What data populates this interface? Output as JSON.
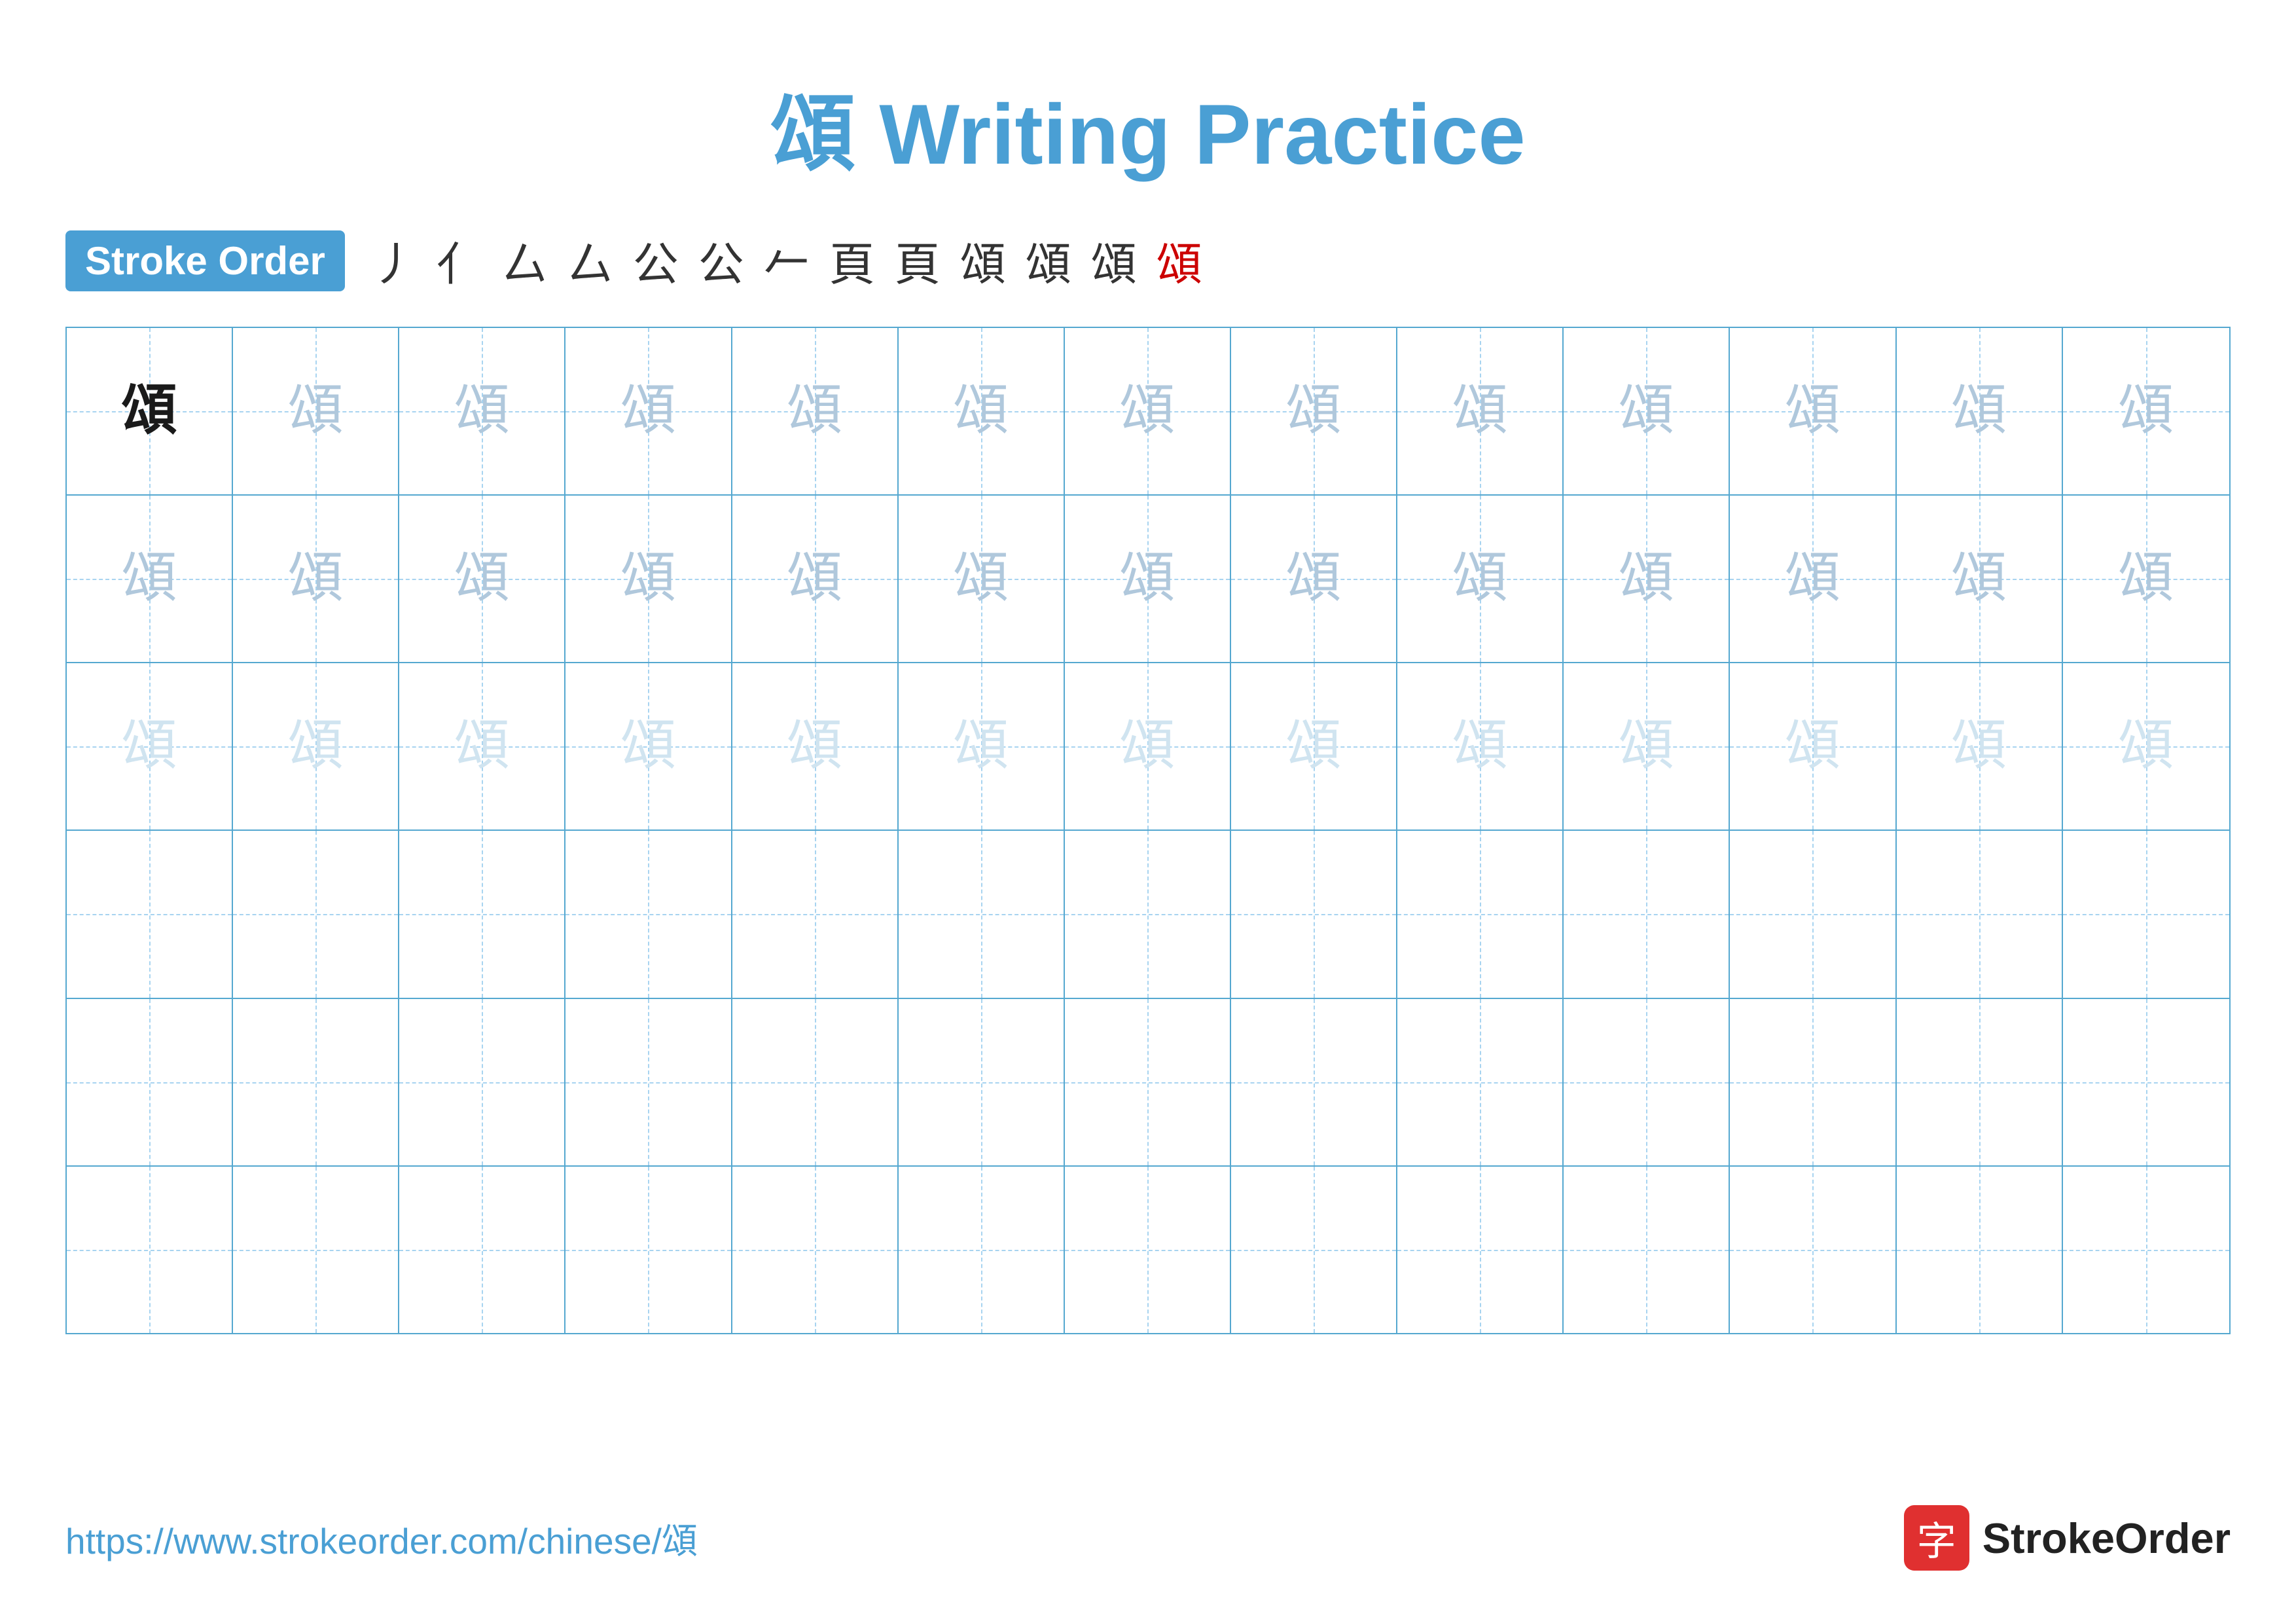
{
  "title": "頌 Writing Practice",
  "stroke_order_badge": "Stroke Order",
  "stroke_steps": [
    "丿",
    "亻",
    "厶",
    "厶",
    "公",
    "公",
    "𠂉",
    "頁",
    "頁",
    "頌",
    "頌",
    "頌",
    "頌"
  ],
  "character": "頌",
  "rows": [
    {
      "type": "dark-then-medium",
      "cells": [
        {
          "char": "頌",
          "style": "dark"
        },
        {
          "char": "頌",
          "style": "medium"
        },
        {
          "char": "頌",
          "style": "medium"
        },
        {
          "char": "頌",
          "style": "medium"
        },
        {
          "char": "頌",
          "style": "medium"
        },
        {
          "char": "頌",
          "style": "medium"
        },
        {
          "char": "頌",
          "style": "medium"
        },
        {
          "char": "頌",
          "style": "medium"
        },
        {
          "char": "頌",
          "style": "medium"
        },
        {
          "char": "頌",
          "style": "medium"
        },
        {
          "char": "頌",
          "style": "medium"
        },
        {
          "char": "頌",
          "style": "medium"
        },
        {
          "char": "頌",
          "style": "medium"
        }
      ]
    },
    {
      "type": "medium",
      "cells": [
        {
          "char": "頌",
          "style": "medium"
        },
        {
          "char": "頌",
          "style": "medium"
        },
        {
          "char": "頌",
          "style": "medium"
        },
        {
          "char": "頌",
          "style": "medium"
        },
        {
          "char": "頌",
          "style": "medium"
        },
        {
          "char": "頌",
          "style": "medium"
        },
        {
          "char": "頌",
          "style": "medium"
        },
        {
          "char": "頌",
          "style": "medium"
        },
        {
          "char": "頌",
          "style": "medium"
        },
        {
          "char": "頌",
          "style": "medium"
        },
        {
          "char": "頌",
          "style": "medium"
        },
        {
          "char": "頌",
          "style": "medium"
        },
        {
          "char": "頌",
          "style": "medium"
        }
      ]
    },
    {
      "type": "light",
      "cells": [
        {
          "char": "頌",
          "style": "light"
        },
        {
          "char": "頌",
          "style": "light"
        },
        {
          "char": "頌",
          "style": "light"
        },
        {
          "char": "頌",
          "style": "light"
        },
        {
          "char": "頌",
          "style": "light"
        },
        {
          "char": "頌",
          "style": "light"
        },
        {
          "char": "頌",
          "style": "light"
        },
        {
          "char": "頌",
          "style": "light"
        },
        {
          "char": "頌",
          "style": "light"
        },
        {
          "char": "頌",
          "style": "light"
        },
        {
          "char": "頌",
          "style": "light"
        },
        {
          "char": "頌",
          "style": "light"
        },
        {
          "char": "頌",
          "style": "light"
        }
      ]
    },
    {
      "type": "empty"
    },
    {
      "type": "empty"
    },
    {
      "type": "empty"
    }
  ],
  "footer": {
    "url": "https://www.strokeorder.com/chinese/頌",
    "logo_char": "字",
    "logo_name": "StrokeOrder"
  }
}
